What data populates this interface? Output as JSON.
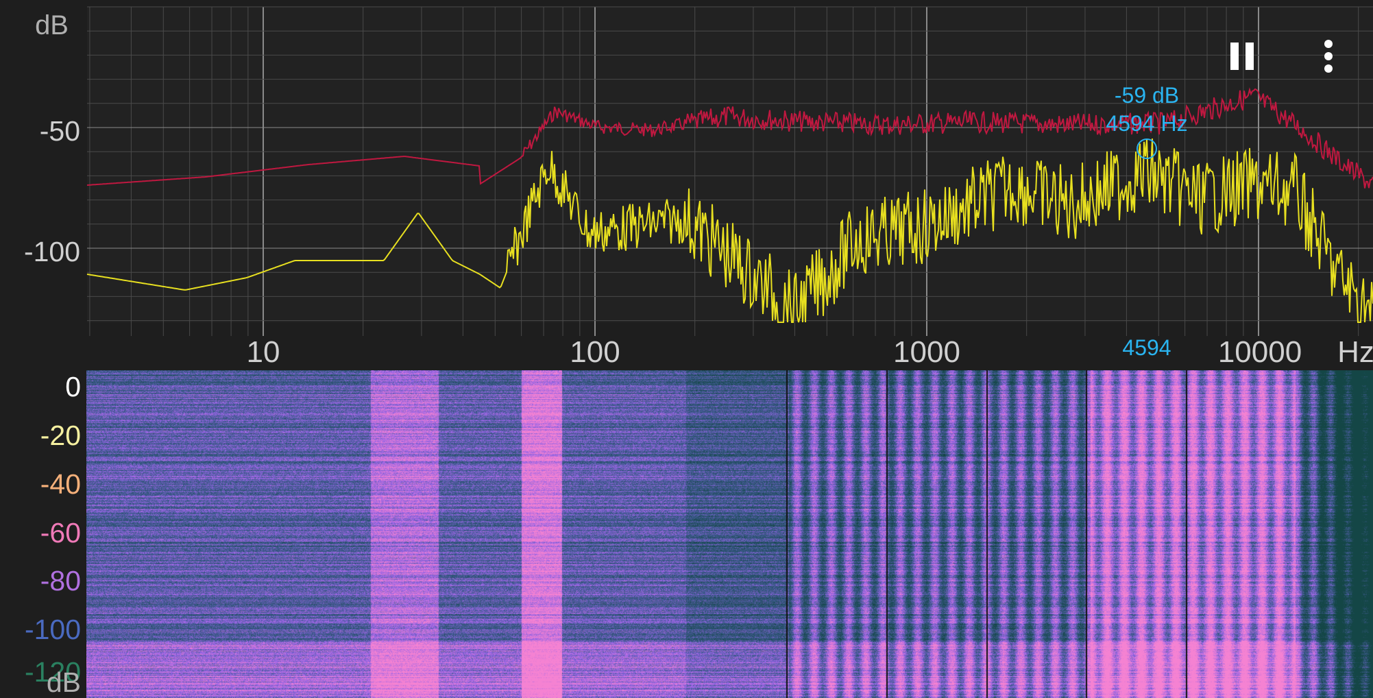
{
  "spectrum": {
    "y_unit": "dB",
    "y_ticks": [
      "-50",
      "-100"
    ],
    "x_unit": "Hz",
    "x_ticks": [
      "10",
      "100",
      "1000",
      "10000"
    ],
    "cursor": {
      "db_text": "-59 dB",
      "hz_text": "4594 Hz",
      "axis_text": "4594"
    },
    "colors": {
      "peak_line": "#c01840",
      "live_line": "#e8e020",
      "cursor": "#2ab4f0",
      "grid": "#5a5a5a",
      "background": "#1e1e1e"
    }
  },
  "controls": {
    "pause_icon": "pause-icon",
    "menu_icon": "more-vert-icon"
  },
  "spectrogram": {
    "y_unit": "dB",
    "scale": [
      {
        "label": "0",
        "color": "#ffffff"
      },
      {
        "label": "-20",
        "color": "#f5f0a0"
      },
      {
        "label": "-40",
        "color": "#f5b07a"
      },
      {
        "label": "-60",
        "color": "#f07ab8"
      },
      {
        "label": "-80",
        "color": "#b070e0"
      },
      {
        "label": "-100",
        "color": "#4a6ac0"
      },
      {
        "label": "-120",
        "color": "#2a8060"
      }
    ]
  }
}
